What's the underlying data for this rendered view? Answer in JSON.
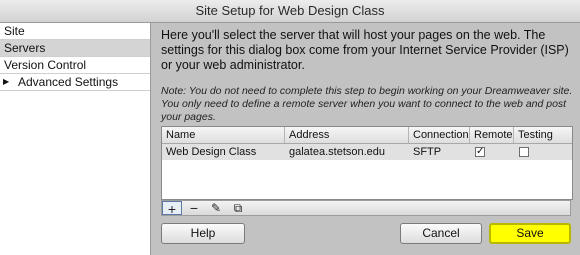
{
  "window": {
    "title": "Site Setup for Web Design Class"
  },
  "sidebar": {
    "items": [
      {
        "label": "Site"
      },
      {
        "label": "Servers"
      },
      {
        "label": "Version Control"
      },
      {
        "label": "Advanced Settings"
      }
    ],
    "selected": "Servers"
  },
  "main": {
    "intro": "Here you'll select the server that will host your pages on the web. The settings for this dialog box come from your Internet Service Provider (ISP) or your web administrator.",
    "note": "Note: You do not need to complete this step to begin working on your Dreamweaver site. You only need to define a remote server when you want to connect to the web and post your pages."
  },
  "table": {
    "columns": [
      "Name",
      "Address",
      "Connection",
      "Remote",
      "Testing"
    ],
    "rows": [
      {
        "name": "Web Design Class",
        "address": "galatea.stetson.edu",
        "connection": "SFTP",
        "remote": true,
        "testing": false
      }
    ]
  },
  "toolbar": {
    "icons": [
      "plus-icon",
      "minus-icon",
      "pencil-icon",
      "duplicate-icon"
    ],
    "symbols": {
      "add": "+",
      "remove": "−",
      "edit": "✎",
      "duplicate": "⧉"
    }
  },
  "buttons": {
    "help": "Help",
    "cancel": "Cancel",
    "save": "Save"
  },
  "colors": {
    "save_button": "#ffff00",
    "selected_row": "#e1e1e1",
    "sidebar_selected": "#d4d4d4"
  }
}
